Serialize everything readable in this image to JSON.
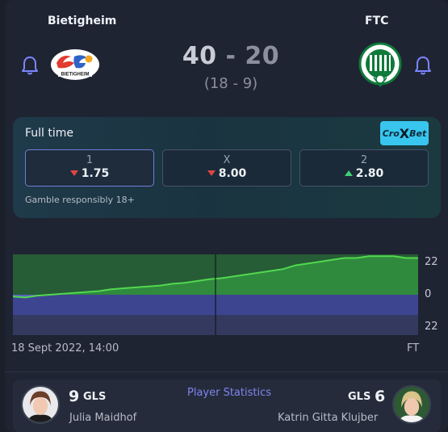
{
  "home": {
    "name": "Bietigheim",
    "score": "40",
    "logo_text": "BIETIGHEIM"
  },
  "away": {
    "name": "FTC",
    "score": "20"
  },
  "score_separator": "-",
  "halftime": "(18 - 9)",
  "icons": {
    "bell": "bell-icon",
    "home_logo": "sg-bietigheim-logo",
    "away_logo": "ftc-crest-logo",
    "brand": "crobet-logo"
  },
  "odds": {
    "title": "Full time",
    "brand": {
      "pre": "Cro",
      "x": "X",
      "post": "Bet"
    },
    "options": [
      {
        "label": "1",
        "value": "1.75",
        "trend": "down"
      },
      {
        "label": "X",
        "value": "8.00",
        "trend": "down"
      },
      {
        "label": "2",
        "value": "2.80",
        "trend": "up"
      }
    ],
    "note": "Gamble responsibly 18+"
  },
  "chart_data": {
    "type": "area",
    "x_labels": [
      "18 Sept 2022, 14:00",
      "FT"
    ],
    "y_ticks": [
      "22",
      "0",
      "22"
    ],
    "ylim": [
      -22,
      22
    ],
    "series": [
      {
        "values": [
          -1,
          -1.5,
          -0.5,
          0,
          0.5,
          1,
          1.5,
          2,
          3,
          3.5,
          4,
          4.5,
          5,
          6,
          6.5,
          7.5,
          8.5,
          9,
          10,
          11,
          12,
          13,
          14,
          16,
          17,
          18,
          19,
          20,
          20,
          21,
          21,
          21,
          20,
          20
        ]
      }
    ],
    "colors": {
      "positive": "#2c8a3b",
      "negative": "#3d4591",
      "line": "#52d84f",
      "band_dark": "#265c36",
      "band_light": "#2f8a3e"
    }
  },
  "players": {
    "home": {
      "goals": "9",
      "goals_label": "GLS",
      "name": "Julia Maidhof"
    },
    "away": {
      "goals": "6",
      "goals_label": "GLS",
      "name": "Katrin Gitta Klujber"
    },
    "link": "Player Statistics"
  }
}
